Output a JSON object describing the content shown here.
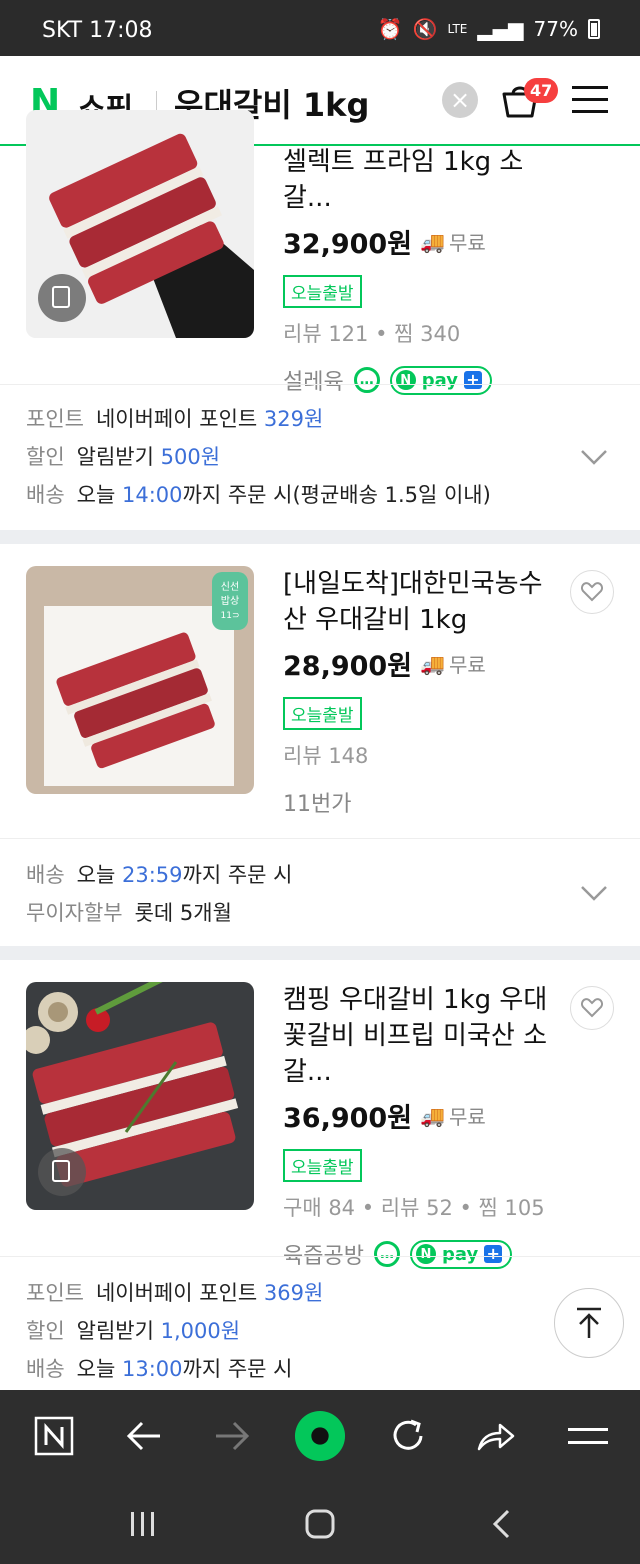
{
  "status": {
    "carrier": "SKT",
    "time": "17:08",
    "battery": "77%",
    "network": "LTE"
  },
  "header": {
    "logo_n": "N",
    "logo_text": "쇼핑",
    "query": "우대갈비 1kg",
    "cart_count": "47"
  },
  "products": [
    {
      "title": "셀렉트 프라임 1kg 소갈...",
      "price": "32,900원",
      "delivery": "무료",
      "tag": "오늘출발",
      "meta": "리뷰 121 • 찜 340",
      "seller": "설레육",
      "npay": "pay"
    },
    {
      "title": "[내일도착]대한민국농수산 우대갈비 1kg",
      "price": "28,900원",
      "delivery": "무료",
      "tag": "오늘출발",
      "meta": "리뷰 148",
      "seller": "11번가",
      "badge_line1": "신선",
      "badge_line2": "밥상",
      "badge_line3": "11⊃"
    },
    {
      "title": "캠핑 우대갈비 1kg 우대꽃갈비 비프립 미국산 소갈...",
      "price": "36,900원",
      "delivery": "무료",
      "tag": "오늘출발",
      "meta": "구매 84 • 리뷰 52 • 찜 105",
      "seller": "육즙공방",
      "npay": "pay"
    }
  ],
  "extra1": {
    "point_label": "포인트",
    "point_text": "네이버페이 포인트",
    "point_value": "329원",
    "discount_label": "할인",
    "discount_text": "알림받기",
    "discount_value": "500원",
    "ship_label": "배송",
    "ship_text1": "오늘",
    "ship_time": "14:00",
    "ship_text2": "까지 주문 시(평균배송 1.5일 이내)"
  },
  "extra2": {
    "ship_label": "배송",
    "ship_text1": "오늘",
    "ship_time": "23:59",
    "ship_text2": "까지 주문 시",
    "install_label": "무이자할부",
    "install_text": "롯데 5개월"
  },
  "extra3": {
    "point_label": "포인트",
    "point_text": "네이버페이 포인트",
    "point_value": "369원",
    "discount_label": "할인",
    "discount_text": "알림받기",
    "discount_value": "1,000원",
    "ship_label": "배송",
    "ship_text1": "오늘",
    "ship_time": "13:00",
    "ship_text2": "까지 주문 시"
  },
  "colors": {
    "brand": "#03c75a",
    "highlight": "#3c6fd8",
    "badge": "#f63f3f"
  }
}
